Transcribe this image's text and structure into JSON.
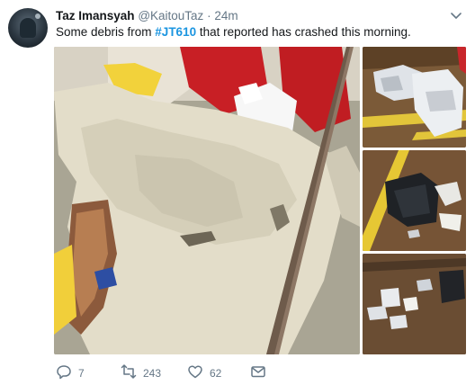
{
  "tweet": {
    "display_name": "Taz Imansyah",
    "handle": "@KaitouTaz",
    "separator": "·",
    "time": "24m",
    "text_before": "Some debris from ",
    "hashtag": "#JT610",
    "text_after": " that reported has crashed this morning."
  },
  "actions": {
    "replies": "7",
    "retweets": "243",
    "likes": "62"
  },
  "icons": {
    "more": "chevron-down-icon",
    "reply": "reply-icon",
    "retweet": "retweet-icon",
    "like": "heart-icon",
    "dm": "envelope-icon"
  },
  "colors": {
    "link": "#1b95e0",
    "secondary_text": "#657786",
    "primary_text": "#14171a"
  }
}
